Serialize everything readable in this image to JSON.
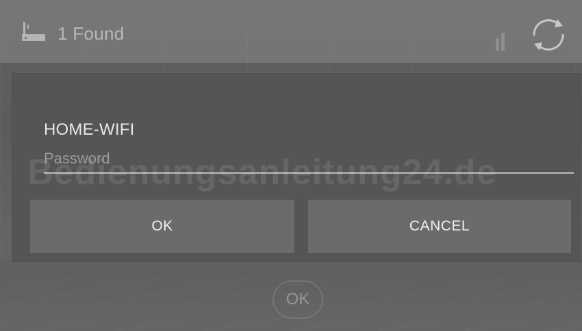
{
  "topbar": {
    "found_label": "1 Found",
    "router_icon": "router-icon",
    "signal_icon": "signal-icon",
    "refresh_icon": "refresh-icon"
  },
  "dialog": {
    "network_name": "HOME-WIFI",
    "password_placeholder": "Password",
    "password_value": "",
    "ok_label": "OK",
    "cancel_label": "CANCEL"
  },
  "background": {
    "ok_label": "OK"
  },
  "watermark": "Bedienungsanleitung24.de"
}
